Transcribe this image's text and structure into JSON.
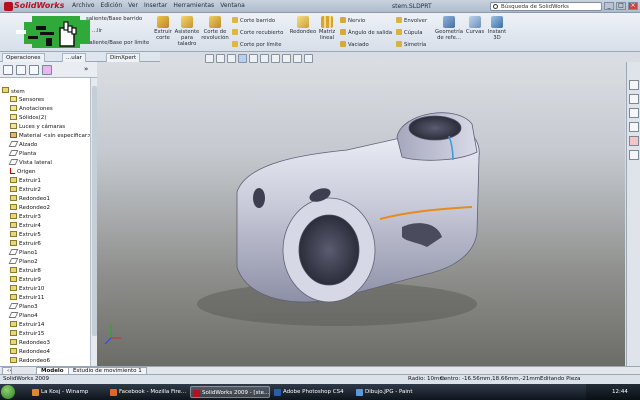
{
  "app": {
    "name": "SolidWorks",
    "document_title": "stem.SLDPRT",
    "status_app": "SolidWorks 2009"
  },
  "menu": [
    "Archivo",
    "Edición",
    "Ver",
    "Insertar",
    "Herramientas",
    "Ventana"
  ],
  "search": {
    "placeholder": "Búsqueda de SolidWorks"
  },
  "ribbon": {
    "small_left": [
      "saliente/Base barrido",
      "...lir",
      "Saliente/Base por límite"
    ],
    "extrude_cut": "Extruir corte",
    "hole_wizard": "Asistente para taladro",
    "revolve_cut": "Corte de revolución",
    "cut_group": [
      "Corte barrido",
      "Corte recubierto",
      "Corte por límite"
    ],
    "fillet": "Redondeo",
    "linear_pattern": "Matriz lineal",
    "features_group": [
      "Nervio",
      "Ángulo de salida",
      "Vaciado"
    ],
    "wrap_group": [
      "Envolver",
      "Cúpula",
      "Simetría"
    ],
    "ref_geometry": "Geometría de refe...",
    "curves": "Curvas",
    "instant3d": "Instant 3D"
  },
  "tabs": [
    "Operaciones",
    "...ular",
    "DimXpert"
  ],
  "tree": {
    "root": "stem",
    "items": [
      {
        "label": "Sensores",
        "icon": "note"
      },
      {
        "label": "Anotaciones",
        "icon": "note"
      },
      {
        "label": "Sólidos(2)",
        "icon": "note"
      },
      {
        "label": "Luces y cámaras",
        "icon": "note"
      },
      {
        "label": "Material <sin especificar>",
        "icon": "mat"
      },
      {
        "label": "Alzado",
        "icon": "plane"
      },
      {
        "label": "Planta",
        "icon": "plane"
      },
      {
        "label": "Vista lateral",
        "icon": "plane"
      },
      {
        "label": "Origen",
        "icon": "origin"
      },
      {
        "label": "Extruir1",
        "icon": "feat"
      },
      {
        "label": "Extruir2",
        "icon": "feat"
      },
      {
        "label": "Redondeo1",
        "icon": "feat"
      },
      {
        "label": "Redondeo2",
        "icon": "feat"
      },
      {
        "label": "Extruir3",
        "icon": "feat"
      },
      {
        "label": "Extruir4",
        "icon": "feat"
      },
      {
        "label": "Extruir5",
        "icon": "feat"
      },
      {
        "label": "Extruir6",
        "icon": "feat"
      },
      {
        "label": "Plano1",
        "icon": "plane"
      },
      {
        "label": "Plano2",
        "icon": "plane"
      },
      {
        "label": "Extruir8",
        "icon": "feat"
      },
      {
        "label": "Extruir9",
        "icon": "feat"
      },
      {
        "label": "Extruir10",
        "icon": "feat"
      },
      {
        "label": "Extruir11",
        "icon": "feat"
      },
      {
        "label": "Plano3",
        "icon": "plane"
      },
      {
        "label": "Plano4",
        "icon": "plane"
      },
      {
        "label": "Extruir14",
        "icon": "feat"
      },
      {
        "label": "Extruir15",
        "icon": "feat"
      },
      {
        "label": "Redondeo3",
        "icon": "feat"
      },
      {
        "label": "Redondeo4",
        "icon": "feat"
      },
      {
        "label": "Redondeo6",
        "icon": "feat"
      }
    ]
  },
  "bottom_tabs": [
    "Modelo",
    "Estudio de movimiento 1"
  ],
  "status": {
    "radius": "Radio: 10mm",
    "center": "Centro: -16.56mm,18.66mm,-21mm",
    "editing": "Editando Pieza"
  },
  "taskbar": {
    "tasks": [
      {
        "label": "La Kosj - Winamp",
        "color": "#d98b2a"
      },
      {
        "label": "Facebook - Mozilla Fire...",
        "color": "#e2652a"
      },
      {
        "label": "SolidWorks 2009 - [ste...",
        "color": "#b3121b"
      },
      {
        "label": "Adobe Photoshop CS4",
        "color": "#2a5fa8"
      },
      {
        "label": "Dibujo.JPG - Paint",
        "color": "#5c9bd6"
      }
    ],
    "clock": "12:44 a.m."
  },
  "colors": {
    "accent": "#b3121b",
    "selection_edge": "#e88a1c",
    "highlight_edge": "#3aa0d8"
  }
}
